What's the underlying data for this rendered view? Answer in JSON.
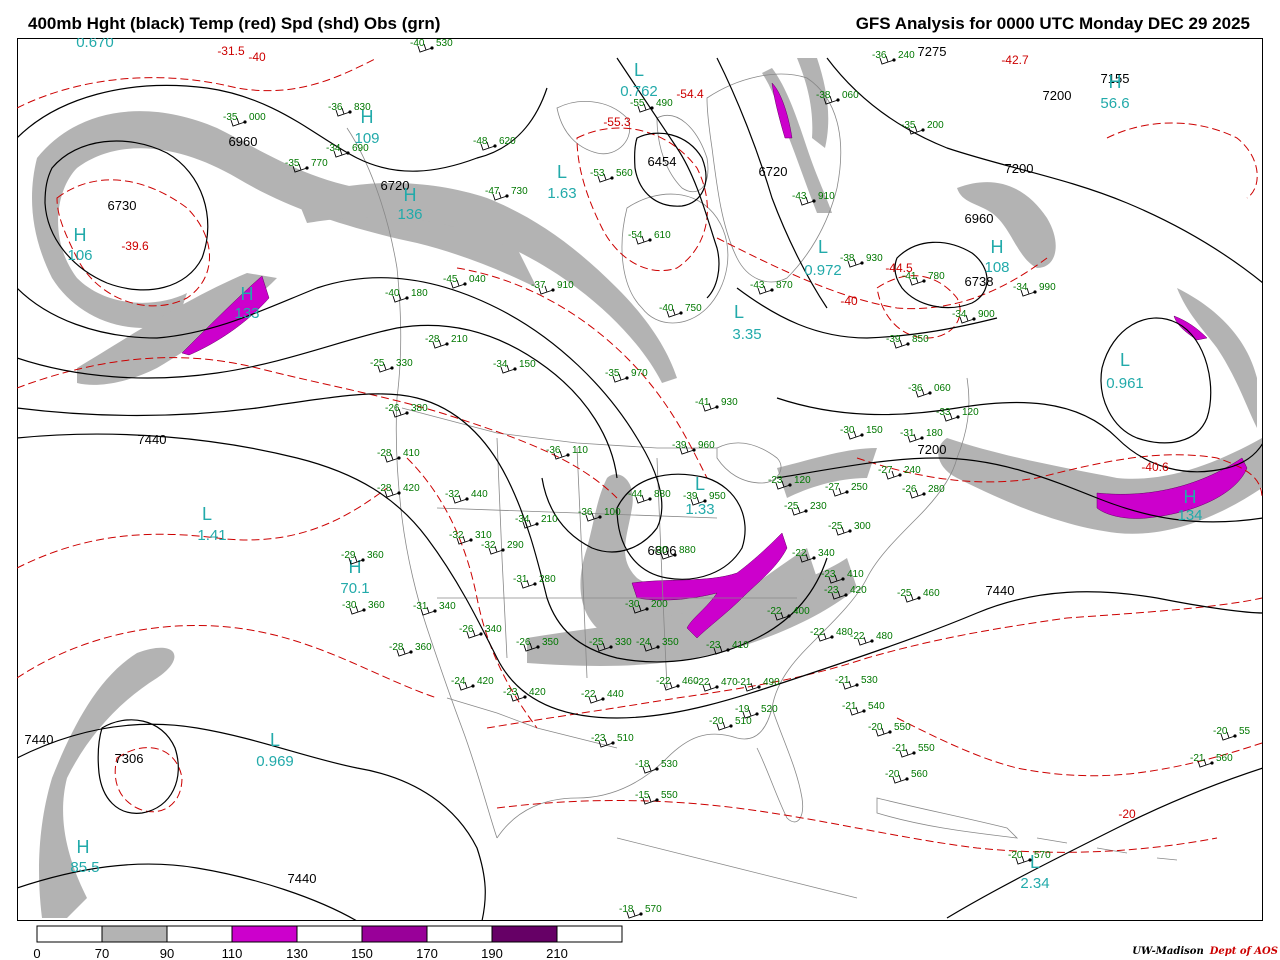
{
  "header": {
    "left_title": "400mb Hght (black) Temp (red) Spd (shd) Obs (grn)",
    "right_title": "GFS Analysis for 0000 UTC Monday  DEC 29 2025"
  },
  "colors": {
    "height": "#000000",
    "temp": "#cc0000",
    "obs": "#007700",
    "extrema": "#22aaaa",
    "speed_70_90": "#b3b3b3",
    "speed_110_130": "#cc00cc",
    "speed_150_170": "#990099",
    "speed_190_210": "#660066",
    "geo": "#888888"
  },
  "colorbar": {
    "ticks": [
      "0",
      "70",
      "90",
      "110",
      "130",
      "150",
      "170",
      "190",
      "210"
    ]
  },
  "credit": {
    "org": "UW-Madison",
    "dept": "Dept of AOS"
  },
  "map": {
    "height_labels": [
      "6730",
      "6960",
      "6720",
      "6454",
      "6720",
      "7275",
      "7155",
      "7200",
      "7200",
      "6960",
      "6738",
      "7440",
      "7200",
      "6806",
      "7440",
      "7306",
      "7440",
      "7440"
    ],
    "temp_labels": [
      "-31.5",
      "-39.6",
      "-54.4",
      "-55.3",
      "-42.7",
      "-44.5",
      "-40",
      "-40.6",
      "-20",
      "-40"
    ],
    "extrema_labels": [
      {
        "sym": "L",
        "val": "0.670"
      },
      {
        "sym": "H",
        "val": "106"
      },
      {
        "sym": "H",
        "val": "133"
      },
      {
        "sym": "L",
        "val": "1.63"
      },
      {
        "sym": "L",
        "val": "0.762"
      },
      {
        "sym": "H",
        "val": "56.6"
      },
      {
        "sym": "L",
        "val": "0.972"
      },
      {
        "sym": "L",
        "val": "3.35"
      },
      {
        "sym": "H",
        "val": "108"
      },
      {
        "sym": "L",
        "val": "0.961"
      },
      {
        "sym": "L",
        "val": "1.41"
      },
      {
        "sym": "L",
        "val": "1.33"
      },
      {
        "sym": "H",
        "val": "134"
      },
      {
        "sym": "L",
        "val": "0.969"
      },
      {
        "sym": "H",
        "val": "85.5"
      },
      {
        "sym": "L",
        "val": "2.34"
      },
      {
        "sym": "H",
        "val": "70.1"
      },
      {
        "sym": "H",
        "val": "109"
      },
      {
        "sym": "H",
        "val": "136"
      }
    ],
    "obs": [
      {
        "t": "-35",
        "h": "000"
      },
      {
        "t": "-35",
        "h": "770"
      },
      {
        "t": "-34",
        "h": "690"
      },
      {
        "t": "-36",
        "h": "830"
      },
      {
        "t": "-40",
        "h": "530"
      },
      {
        "t": "-55",
        "h": "490"
      },
      {
        "t": "-48",
        "h": "620"
      },
      {
        "t": "-53",
        "h": "560"
      },
      {
        "t": "-47",
        "h": "730"
      },
      {
        "t": "-54",
        "h": "610"
      },
      {
        "t": "-38",
        "h": "060"
      },
      {
        "t": "-36",
        "h": "240"
      },
      {
        "t": "-35",
        "h": "200"
      },
      {
        "t": "-43",
        "h": "910"
      },
      {
        "t": "-38",
        "h": "930"
      },
      {
        "t": "-41",
        "h": "780"
      },
      {
        "t": "-34",
        "h": "990"
      },
      {
        "t": "-34",
        "h": "900"
      },
      {
        "t": "-43",
        "h": "870"
      },
      {
        "t": "-40",
        "h": "750"
      },
      {
        "t": "-37",
        "h": "910"
      },
      {
        "t": "-39",
        "h": "850"
      },
      {
        "t": "-40",
        "h": "180"
      },
      {
        "t": "-45",
        "h": "040"
      },
      {
        "t": "-28",
        "h": "210"
      },
      {
        "t": "-34",
        "h": "150"
      },
      {
        "t": "-35",
        "h": "970"
      },
      {
        "t": "-25",
        "h": "330"
      },
      {
        "t": "-26",
        "h": "380"
      },
      {
        "t": "-41",
        "h": "930"
      },
      {
        "t": "-36",
        "h": "060"
      },
      {
        "t": "-33",
        "h": "120"
      },
      {
        "t": "-39",
        "h": "960"
      },
      {
        "t": "-36",
        "h": "110"
      },
      {
        "t": "-30",
        "h": "150"
      },
      {
        "t": "-31",
        "h": "180"
      },
      {
        "t": "-28",
        "h": "410"
      },
      {
        "t": "-28",
        "h": "420"
      },
      {
        "t": "-32",
        "h": "440"
      },
      {
        "t": "-44",
        "h": "880"
      },
      {
        "t": "-39",
        "h": "950"
      },
      {
        "t": "-27",
        "h": "240"
      },
      {
        "t": "-23",
        "h": "120"
      },
      {
        "t": "-27",
        "h": "250"
      },
      {
        "t": "-26",
        "h": "280"
      },
      {
        "t": "-36",
        "h": "100"
      },
      {
        "t": "-34",
        "h": "210"
      },
      {
        "t": "-25",
        "h": "230"
      },
      {
        "t": "-25",
        "h": "300"
      },
      {
        "t": "-32",
        "h": "310"
      },
      {
        "t": "-32",
        "h": "290"
      },
      {
        "t": "-29",
        "h": "360"
      },
      {
        "t": "-30",
        "h": "880"
      },
      {
        "t": "-31",
        "h": "280"
      },
      {
        "t": "-22",
        "h": "340"
      },
      {
        "t": "-23",
        "h": "410"
      },
      {
        "t": "-23",
        "h": "420"
      },
      {
        "t": "-25",
        "h": "460"
      },
      {
        "t": "-30",
        "h": "360"
      },
      {
        "t": "-31",
        "h": "340"
      },
      {
        "t": "-26",
        "h": "340"
      },
      {
        "t": "-30",
        "h": "200"
      },
      {
        "t": "-22",
        "h": "400"
      },
      {
        "t": "-22",
        "h": "480"
      },
      {
        "t": "-22",
        "h": "480"
      },
      {
        "t": "-28",
        "h": "360"
      },
      {
        "t": "-26",
        "h": "350"
      },
      {
        "t": "-25",
        "h": "330"
      },
      {
        "t": "-24",
        "h": "350"
      },
      {
        "t": "-23",
        "h": "410"
      },
      {
        "t": "-22",
        "h": "470"
      },
      {
        "t": "-22",
        "h": "460"
      },
      {
        "t": "-24",
        "h": "420"
      },
      {
        "t": "-23",
        "h": "420"
      },
      {
        "t": "-22",
        "h": "440"
      },
      {
        "t": "-21",
        "h": "490"
      },
      {
        "t": "-21",
        "h": "530"
      },
      {
        "t": "-21",
        "h": "540"
      },
      {
        "t": "-20",
        "h": "510"
      },
      {
        "t": "-19",
        "h": "520"
      },
      {
        "t": "-23",
        "h": "510"
      },
      {
        "t": "-20",
        "h": "550"
      },
      {
        "t": "-21",
        "h": "550"
      },
      {
        "t": "-18",
        "h": "530"
      },
      {
        "t": "-20",
        "h": "560"
      },
      {
        "t": "-15",
        "h": "550"
      },
      {
        "t": "-21",
        "h": "560"
      },
      {
        "t": "-20",
        "h": "570"
      },
      {
        "t": "-18",
        "h": "570"
      },
      {
        "t": "-20",
        "h": "55"
      }
    ]
  }
}
